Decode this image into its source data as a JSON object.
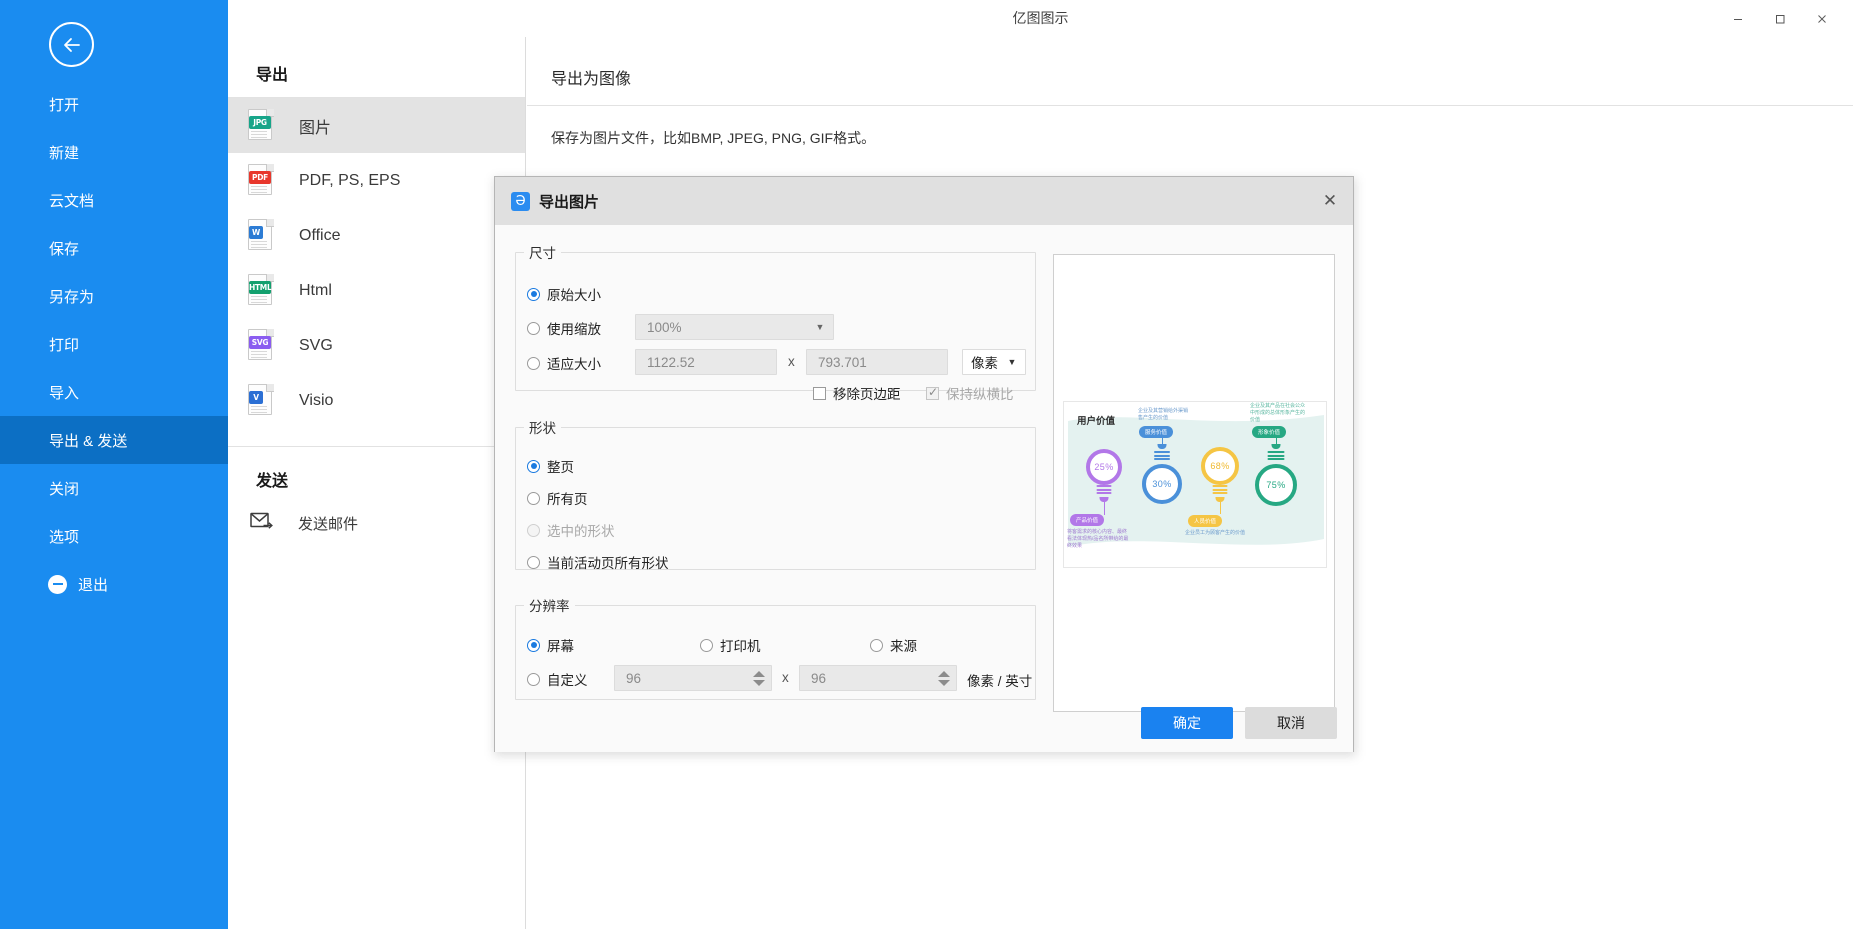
{
  "window": {
    "title": "亿图图示",
    "minimize": "−",
    "maximize": "▭",
    "close": "✕"
  },
  "top_right": {
    "chat_icon": "chat-icon",
    "more_dots": "...",
    "vip_icon": "vip-diamond-icon",
    "caret": "▾"
  },
  "sidebar": {
    "back_icon": "back-arrow-icon",
    "items": [
      {
        "label": "打开",
        "active": false
      },
      {
        "label": "新建",
        "active": false
      },
      {
        "label": "云文档",
        "active": false
      },
      {
        "label": "保存",
        "active": false
      },
      {
        "label": "另存为",
        "active": false
      },
      {
        "label": "打印",
        "active": false
      },
      {
        "label": "导入",
        "active": false
      },
      {
        "label": "导出 & 发送",
        "active": true
      },
      {
        "label": "关闭",
        "active": false
      },
      {
        "label": "选项",
        "active": false
      }
    ],
    "exit": "退出"
  },
  "export_panel": {
    "heading": "导出",
    "formats": [
      {
        "label": "图片",
        "tag": "JPG",
        "color": "#17a589",
        "active": true
      },
      {
        "label": "PDF, PS, EPS",
        "tag": "PDF",
        "color": "#e8372c",
        "active": false
      },
      {
        "label": "Office",
        "tag": "W",
        "color": "#2b7bd4",
        "active": false
      },
      {
        "label": "Html",
        "tag": "HTML",
        "color": "#13a06e",
        "active": false
      },
      {
        "label": "SVG",
        "tag": "SVG",
        "color": "#8a5cf0",
        "active": false
      },
      {
        "label": "Visio",
        "tag": "V",
        "color": "#2b6fd4",
        "active": false
      }
    ],
    "send_heading": "发送",
    "send_item": "发送邮件",
    "send_icon": "mail-forward-icon"
  },
  "detail": {
    "title": "导出为图像",
    "description": "保存为图片文件，比如BMP, JPEG, PNG, GIF格式。"
  },
  "dialog": {
    "app_icon": "eddx-app-icon",
    "title": "导出图片",
    "close_icon": "✕",
    "size_group": {
      "legend": "尺寸",
      "original": {
        "label": "原始大小",
        "checked": true
      },
      "scale": {
        "label": "使用缩放",
        "checked": false,
        "value": "100%"
      },
      "fit": {
        "label": "适应大小",
        "checked": false,
        "width": "1122.52",
        "height": "793.701",
        "separator": "x",
        "unit": "像素"
      },
      "remove_margin": {
        "label": "移除页边距",
        "checked": false
      },
      "keep_ratio": {
        "label": "保持纵横比",
        "checked": true,
        "disabled": true
      }
    },
    "shape_group": {
      "legend": "形状",
      "options": [
        {
          "label": "整页",
          "checked": true,
          "disabled": false
        },
        {
          "label": "所有页",
          "checked": false,
          "disabled": false
        },
        {
          "label": "选中的形状",
          "checked": false,
          "disabled": true
        },
        {
          "label": "当前活动页所有形状",
          "checked": false,
          "disabled": false
        }
      ]
    },
    "resolution_group": {
      "legend": "分辨率",
      "options": [
        {
          "label": "屏幕",
          "checked": true
        },
        {
          "label": "打印机",
          "checked": false
        },
        {
          "label": "来源",
          "checked": false
        }
      ],
      "custom": {
        "label": "自定义",
        "checked": false,
        "x": "96",
        "y": "96",
        "separator": "x",
        "unit": "像素 / 英寸"
      }
    },
    "buttons": {
      "ok": "确定",
      "cancel": "取消"
    }
  },
  "preview": {
    "title": "用户价值",
    "bulbs": [
      {
        "percent": "25%",
        "color": "#b277e8",
        "pill": "产品价值",
        "pill_pos": "bottom",
        "caption": "将客需求的核心内容、最终看法体现热/品名所带给的最终效果",
        "caption_pos": "bottom"
      },
      {
        "percent": "30%",
        "color": "#4a90d9",
        "pill": "服务价值",
        "pill_pos": "top",
        "caption": "企业及其营销给外渠销售产生的价值",
        "caption_pos": "top"
      },
      {
        "percent": "68%",
        "color": "#f5c544",
        "pill": "人员价值",
        "pill_pos": "bottom",
        "caption": "企业员工为顾客产生的价值",
        "caption_pos": "bottom"
      },
      {
        "percent": "75%",
        "color": "#26a883",
        "pill": "形象价值",
        "pill_pos": "top",
        "caption": "企业及其产品在社会公众中形成的总体形象产生的价值",
        "caption_pos": "top"
      }
    ]
  }
}
